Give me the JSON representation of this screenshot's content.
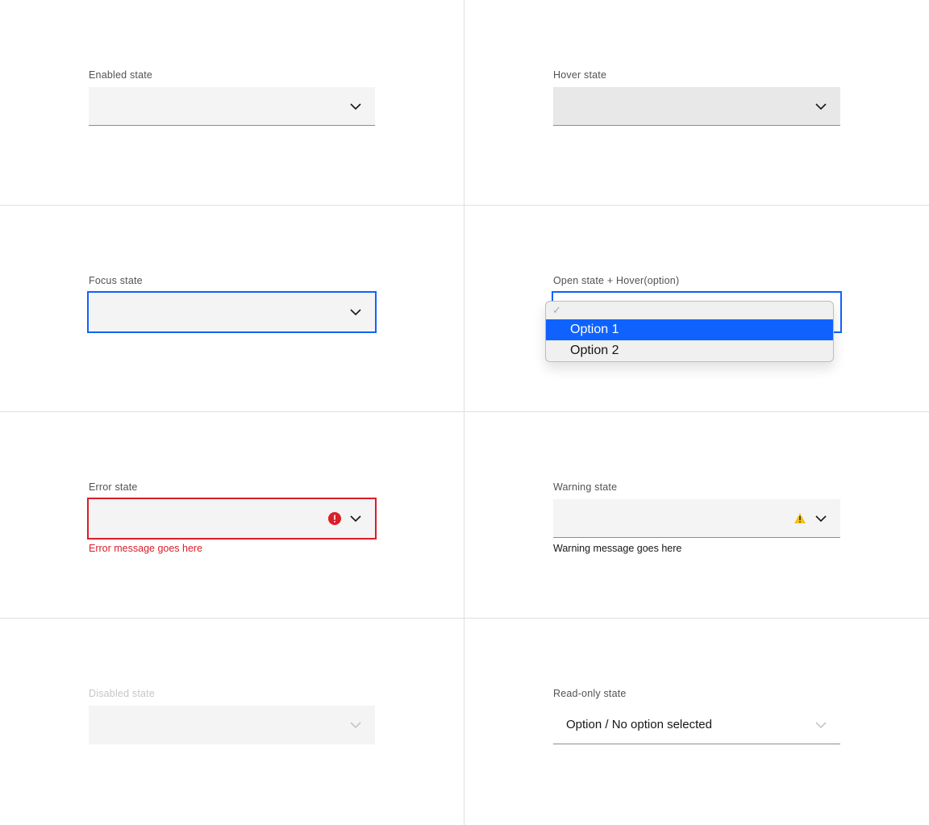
{
  "colors": {
    "focus": "#0f62fe",
    "error": "#da1e28",
    "warning": "#f1c21b"
  },
  "states": {
    "enabled": {
      "label": "Enabled state"
    },
    "hover": {
      "label": "Hover state"
    },
    "focus": {
      "label": "Focus state"
    },
    "open": {
      "label": "Open state + Hover(option)",
      "options": [
        "Option 1",
        "Option 2"
      ],
      "hovered_index": 0
    },
    "error": {
      "label": "Error state",
      "message": "Error message goes here"
    },
    "warning": {
      "label": "Warning state",
      "message": "Warning message goes here"
    },
    "disabled": {
      "label": "Disabled state"
    },
    "readonly": {
      "label": "Read-only state",
      "value": "Option / No option selected"
    }
  }
}
